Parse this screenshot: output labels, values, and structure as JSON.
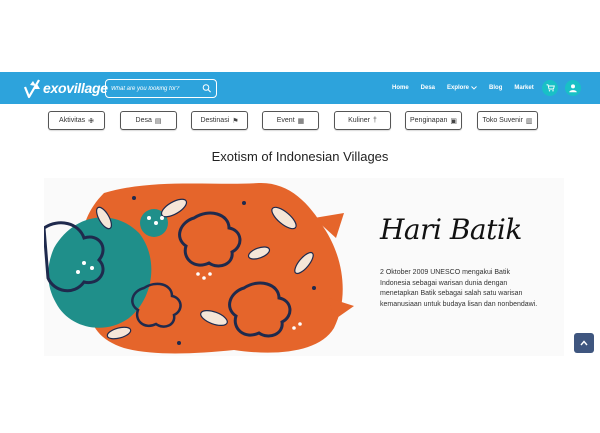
{
  "header": {
    "logo_text": "exovillage",
    "search_placeholder": "What are you looking for?",
    "nav": [
      {
        "label": "Home"
      },
      {
        "label": "Desa"
      },
      {
        "label": "Explore"
      },
      {
        "label": "Blog"
      },
      {
        "label": "Market"
      }
    ]
  },
  "categories": [
    {
      "label": "Aktivitas",
      "icon": "activity-icon"
    },
    {
      "label": "Desa",
      "icon": "village-icon"
    },
    {
      "label": "Destinasi",
      "icon": "location-pin-icon"
    },
    {
      "label": "Event",
      "icon": "calendar-icon"
    },
    {
      "label": "Kuliner",
      "icon": "culinary-icon"
    },
    {
      "label": "Penginapan",
      "icon": "bed-icon"
    },
    {
      "label": "Toko Suvenir",
      "icon": "shop-icon"
    }
  ],
  "main": {
    "title": "Exotism of Indonesian Villages"
  },
  "banner": {
    "heading": "Hari Batik",
    "text": "2 Oktober 2009 UNESCO mengakui Batik Indonesia sebagai warisan dunia dengan menetapkan Batik sebagai salah satu warisan kemanusiaan untuk budaya lisan dan nonbendawi."
  },
  "colors": {
    "navbar": "#2da3dc",
    "accent_button": "#19c0c6",
    "scroll_top": "#3f567f",
    "batik_orange": "#e5652b",
    "batik_teal": "#1f8f8a",
    "batik_navy": "#1f2a4d"
  }
}
